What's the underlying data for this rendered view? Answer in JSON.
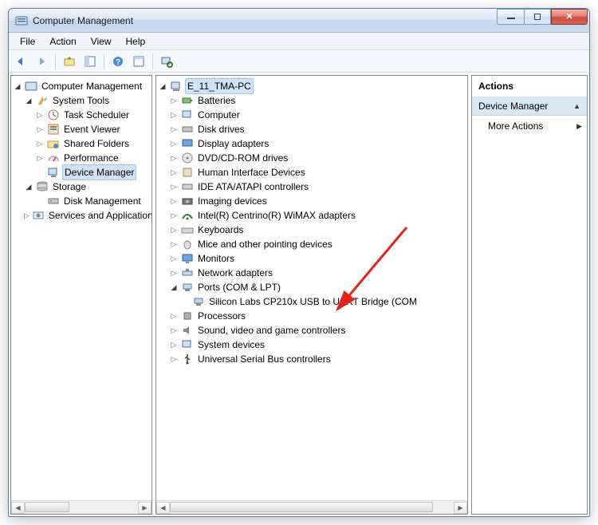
{
  "title": "Computer Management",
  "menu": {
    "file": "File",
    "action": "Action",
    "view": "View",
    "help": "Help"
  },
  "left_tree": {
    "root": "Computer Management",
    "system_tools": "System Tools",
    "task_scheduler": "Task Scheduler",
    "event_viewer": "Event Viewer",
    "shared_folders": "Shared Folders",
    "performance": "Performance",
    "device_manager": "Device Manager",
    "storage": "Storage",
    "disk_management": "Disk Management",
    "services": "Services and Applications"
  },
  "center_tree": {
    "computer_name": "E_11_TMA-PC",
    "batteries": "Batteries",
    "computer": "Computer",
    "disk_drives": "Disk drives",
    "display_adapters": "Display adapters",
    "dvd": "DVD/CD-ROM drives",
    "hid": "Human Interface Devices",
    "ide": "IDE ATA/ATAPI controllers",
    "imaging": "Imaging devices",
    "wimax": "Intel(R) Centrino(R) WiMAX adapters",
    "keyboards": "Keyboards",
    "mice": "Mice and other pointing devices",
    "monitors": "Monitors",
    "network": "Network adapters",
    "ports": "Ports (COM & LPT)",
    "uart": "Silicon Labs CP210x USB to UART Bridge (COM",
    "processors": "Processors",
    "sound": "Sound, video and game controllers",
    "system_devices": "System devices",
    "usb": "Universal Serial Bus controllers"
  },
  "actions": {
    "title": "Actions",
    "selected": "Device Manager",
    "more": "More Actions"
  }
}
